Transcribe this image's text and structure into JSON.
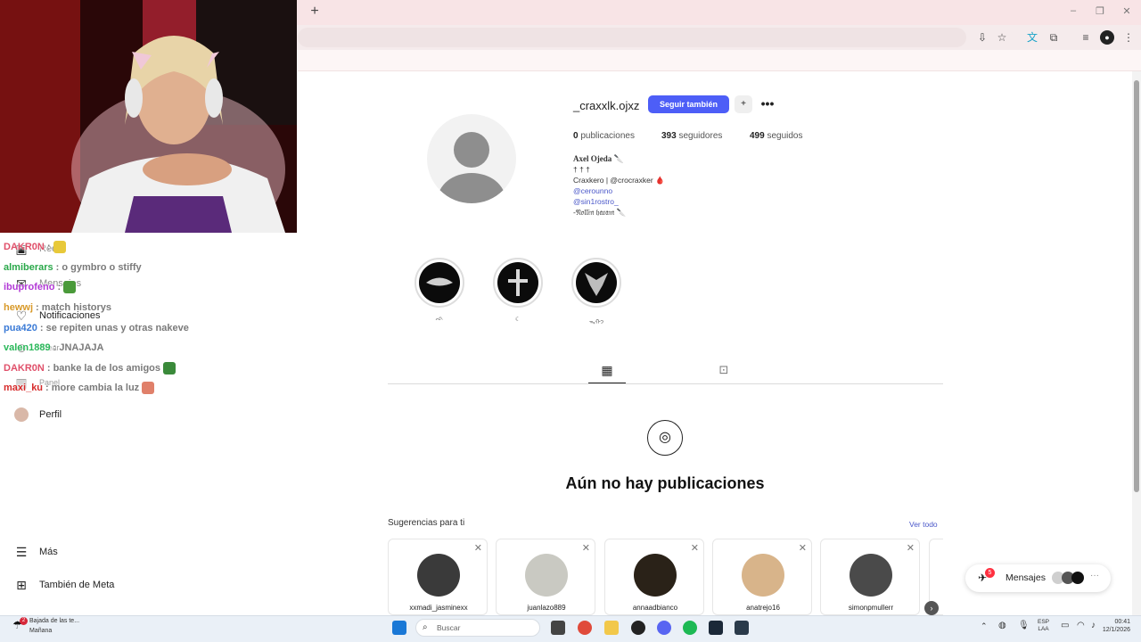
{
  "browser": {
    "new_tab_symbol": "+",
    "window_controls": [
      "–",
      "❐",
      "✕"
    ]
  },
  "sidebar": {
    "items": [
      {
        "label": "Reels",
        "icon": "reels-icon"
      },
      {
        "label": "Mensajes",
        "icon": "messenger-icon",
        "badge": "5"
      },
      {
        "label": "Notificaciones",
        "icon": "heart-icon"
      },
      {
        "label": "Crear",
        "icon": "plus-icon"
      },
      {
        "label": "Panel",
        "icon": "chart-icon"
      },
      {
        "label": "Perfil",
        "icon": "profile-avatar"
      },
      {
        "label": "Más",
        "icon": "menu-icon"
      },
      {
        "label": "También de Meta",
        "icon": "grid-icon"
      }
    ]
  },
  "chat": [
    {
      "user": "DAKR0N",
      "text": ":",
      "color": "#e0506a",
      "emote": "#e8c93a"
    },
    {
      "user": "almiberars",
      "text": ": o gymbro o stiffy",
      "color": "#2aa84a",
      "emote": ""
    },
    {
      "user": "ibuprofeno",
      "text": ":",
      "color": "#b23ad6",
      "emote": "#4a9a3a"
    },
    {
      "user": "hewwj",
      "text": ": match historys",
      "color": "#d89a2a",
      "emote": ""
    },
    {
      "user": "pua420",
      "text": ": se repiten unas y otras nakeve",
      "color": "#3a7ad6",
      "emote": ""
    },
    {
      "user": "valen1889",
      "text": ": JNAJAJA",
      "color": "#2ab85a",
      "emote": ""
    },
    {
      "user": "DAKR0N",
      "text": ": banke la de los amigos",
      "color": "#e0506a",
      "emote": "#3a8a3a"
    },
    {
      "user": "maxi_ku",
      "text": ": more cambia la luz",
      "color": "#d62a2a",
      "emote": "#e0806a"
    }
  ],
  "profile": {
    "username": "_craxxlk.ojxz",
    "follow_button": "Seguir también",
    "adduser_symbol": "+",
    "more_symbol": "•••",
    "stats": {
      "posts_count": "0",
      "posts_label": "publicaciones",
      "followers_count": "393",
      "followers_label": "seguidores",
      "following_count": "499",
      "following_label": "seguidos"
    },
    "bio": {
      "name": "Axel Ojeda 🔪",
      "line1": "† † †",
      "line2": "Craxkero | @crocraxker 🩸",
      "link1": "@cerounno",
      "link2": "@sin1rostro_",
      "line3": "-𝔑𝔬𝔩𝔩𝔦𝔫 𝔥𝔞𝔯𝔞𝔪 🔪"
    },
    "highlights": [
      {
        "label": "ᨒ"
      },
      {
        "label": "☾"
      },
      {
        "label": "ᯓᡣ𐭩"
      }
    ],
    "empty_title": "Aún no hay publicaciones"
  },
  "suggestions": {
    "title": "Sugerencias para ti",
    "see_all": "Ver todo",
    "cards": [
      {
        "username": "xxmadi_jasminexx",
        "color": "#3a3a3a"
      },
      {
        "username": "juanlazo889",
        "color": "#c9c9c2"
      },
      {
        "username": "annaadbianco",
        "color": "#2a2218"
      },
      {
        "username": "anatrejo16",
        "color": "#d8b48a"
      },
      {
        "username": "simonpmullerr",
        "color": "#4a4a4a"
      }
    ]
  },
  "messages_pill": {
    "label": "Mensajes",
    "badge": "5"
  },
  "taskbar": {
    "weather_line1": "Bajada de las te...",
    "weather_line2": "Mañana",
    "weather_badge": "2",
    "search_placeholder": "Buscar",
    "lang1": "ESP",
    "lang2": "LAA",
    "time": "00:41",
    "date": "12/1/2026"
  },
  "colors": {
    "accent": "#4d5ef7",
    "link": "#4a57c9",
    "tabbar": "#f8e4e6"
  }
}
